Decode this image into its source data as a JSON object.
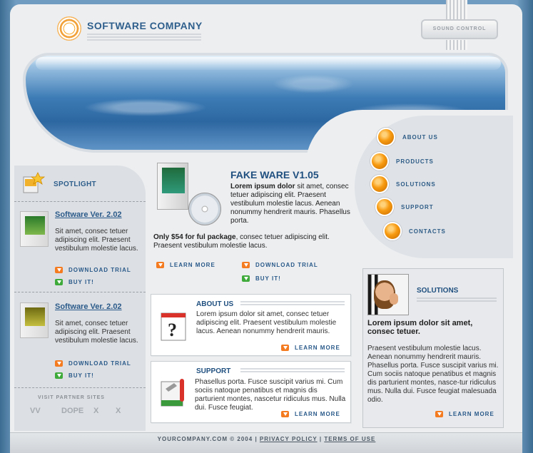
{
  "header": {
    "logo_text": "SOFTWARE COMPANY",
    "sound_control": "SOUND CONTROL"
  },
  "nav": {
    "items": [
      {
        "label": "ABOUT US"
      },
      {
        "label": "PRODUCTS"
      },
      {
        "label": "SOLUTIONS"
      },
      {
        "label": "SUPPORT"
      },
      {
        "label": "CONTACTS"
      }
    ]
  },
  "spotlight": {
    "title": "SPOTLIGHT",
    "items": [
      {
        "title": "Software Ver. 2.02",
        "text": "Sit amet, consec tetuer adipiscing elit. Praesent vestibulum molestie lacus.",
        "download": "DOWNLOAD TRIAL",
        "buy": "BUY IT!"
      },
      {
        "title": "Software Ver. 2.02",
        "text": "Sit amet, consec tetuer adipiscing elit. Praesent vestibulum molestie lacus.",
        "download": "DOWNLOAD TRIAL",
        "buy": "BUY IT!"
      }
    ],
    "partners_title": "VISIT PARTNER SITES",
    "partners": [
      "VV",
      "DOPE",
      "X",
      "X"
    ]
  },
  "featured": {
    "title": "FAKE WARE V1.05",
    "lead": "Lorem ipsum dolor",
    "text": " sit amet, consec tetuer adipiscing elit. Praesent vestibulum molestie lacus. Aenean nonummy hendrerit mauris. Phasellus porta.",
    "price_bold": "Only $54 for ful package",
    "price_text": ", consec tetuer adipiscing elit. Praesent vestibulum molestie lacus.",
    "learn_more": "LEARN MORE",
    "download": "DOWNLOAD TRIAL",
    "buy": "BUY IT!"
  },
  "about": {
    "title": "ABOUT US",
    "text": "Lorem ipsum dolor sit amet, consec tetuer adipiscing elit. Praesent vestibulum molestie lacus. Aenean nonummy hendrerit mauris.",
    "learn_more": "LEARN MORE"
  },
  "support": {
    "title": "SUPPORT",
    "text": "Phasellus porta. Fusce suscipit varius mi. Cum sociis natoque penatibus et magnis dis parturient montes, nascetur ridiculus mus. Nulla dui. Fusce feugiat.",
    "learn_more": "LEARN MORE"
  },
  "solutions": {
    "title": "SOLUTIONS",
    "headline": "Lorem ipsum dolor sit amet, consec tetuer.",
    "text": "Praesent vestibulum molestie lacus. Aenean nonummy hendrerit mauris. Phasellus porta. Fusce suscipit varius mi. Cum sociis natoque penatibus et magnis dis parturient montes, nasce-tur ridiculus mus. Nulla dui. Fusce feugiat malesuada odio.",
    "learn_more": "LEARN MORE"
  },
  "footer": {
    "copyright": "YOURCOMPANY.COM © 2004",
    "separator": "|",
    "privacy": "PRIVACY POLICY",
    "terms": "TERMS OF USE"
  },
  "colors": {
    "accent": "#2f5f8c",
    "orange": "#f47b20",
    "green": "#3eaa3a"
  }
}
